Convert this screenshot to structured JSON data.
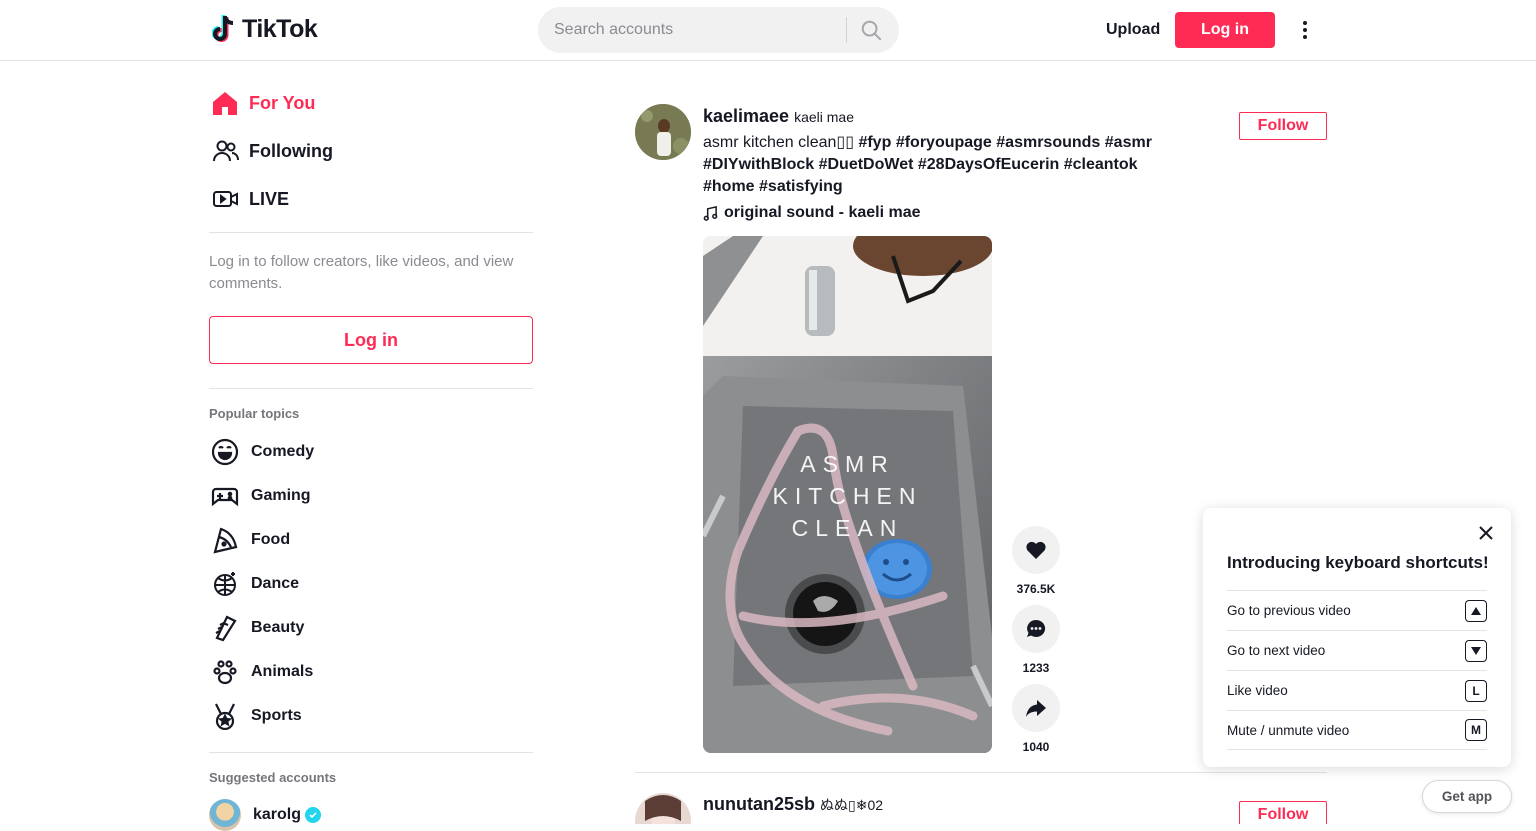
{
  "header": {
    "logo_text": "TikTok",
    "search_placeholder": "Search accounts",
    "upload_label": "Upload",
    "login_label": "Log in"
  },
  "sidebar": {
    "nav": [
      {
        "label": "For You",
        "icon": "home-icon",
        "active": true
      },
      {
        "label": "Following",
        "icon": "following-icon",
        "active": false
      },
      {
        "label": "LIVE",
        "icon": "live-icon",
        "active": false
      }
    ],
    "login_hint": "Log in to follow creators, like videos, and view comments.",
    "login_label": "Log in",
    "topics_title": "Popular topics",
    "topics": [
      {
        "label": "Comedy",
        "icon": "comedy-icon"
      },
      {
        "label": "Gaming",
        "icon": "gaming-icon"
      },
      {
        "label": "Food",
        "icon": "food-icon"
      },
      {
        "label": "Dance",
        "icon": "dance-icon"
      },
      {
        "label": "Beauty",
        "icon": "beauty-icon"
      },
      {
        "label": "Animals",
        "icon": "animals-icon"
      },
      {
        "label": "Sports",
        "icon": "sports-icon"
      }
    ],
    "suggested_title": "Suggested accounts",
    "suggested": [
      {
        "name": "karolg",
        "verified": true
      }
    ]
  },
  "feed": [
    {
      "username": "kaelimaee",
      "display_name": "kaeli mae",
      "follow_label": "Follow",
      "caption_text": "asmr kitchen clean▯▯ ",
      "hashtags": [
        "#fyp",
        "#foryoupage",
        "#asmrsounds",
        "#asmr",
        "#DIYwithBlock",
        "#DuetDoWet",
        "#28DaysOfEucerin",
        "#cleantok",
        "#home",
        "#satisfying"
      ],
      "music": "original sound - kaeli mae",
      "video_overlay_text": "ASMR\nKITCHEN\nCLEAN",
      "likes": "376.5K",
      "comments": "1233",
      "shares": "1040"
    },
    {
      "username": "nunutan25sb",
      "display_name": "ぬぬ▯❄02",
      "follow_label": "Follow"
    }
  ],
  "shortcuts": {
    "title": "Introducing keyboard shortcuts!",
    "items": [
      {
        "label": "Go to previous video",
        "key": "▲"
      },
      {
        "label": "Go to next video",
        "key": "▼"
      },
      {
        "label": "Like video",
        "key": "L"
      },
      {
        "label": "Mute / unmute video",
        "key": "M"
      }
    ]
  },
  "get_app_label": "Get app",
  "colors": {
    "accent": "#fe2c55",
    "text": "#161823",
    "muted": "#8a8b91",
    "border": "#e3e3e4"
  }
}
